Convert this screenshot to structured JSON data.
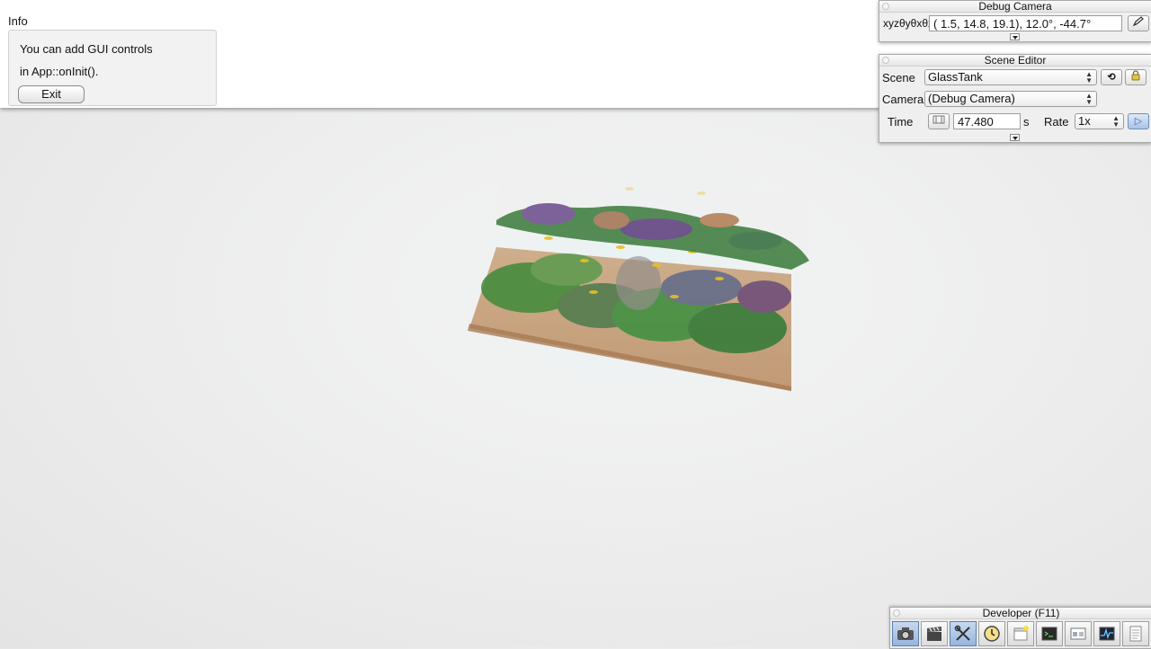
{
  "info": {
    "title": "Info",
    "line1": "You can add GUI controls",
    "line2": "in App::onInit().",
    "exit_label": "Exit"
  },
  "debug_camera": {
    "title": "Debug Camera",
    "label": "xyzθyθxθz",
    "value": "(  1.5,  14.8,  19.1),  12.0°, -44.7°"
  },
  "scene_editor": {
    "title": "Scene Editor",
    "scene_label": "Scene",
    "scene_value": "GlassTank",
    "camera_label": "Camera",
    "camera_value": "(Debug Camera)",
    "time_label": "Time",
    "time_value": "47.480",
    "time_unit": "s",
    "rate_label": "Rate",
    "rate_value": "1x"
  },
  "developer": {
    "title": "Developer (F11)",
    "buttons": [
      "camera-icon",
      "clapperboard-icon",
      "tools-icon",
      "clock-icon",
      "new-window-icon",
      "terminal-icon",
      "scene-graph-icon",
      "profiler-icon",
      "log-icon"
    ]
  },
  "colors": {
    "accent": "#96b5dd",
    "sand": "#c9a27a",
    "plant": "#3f8a3a"
  }
}
